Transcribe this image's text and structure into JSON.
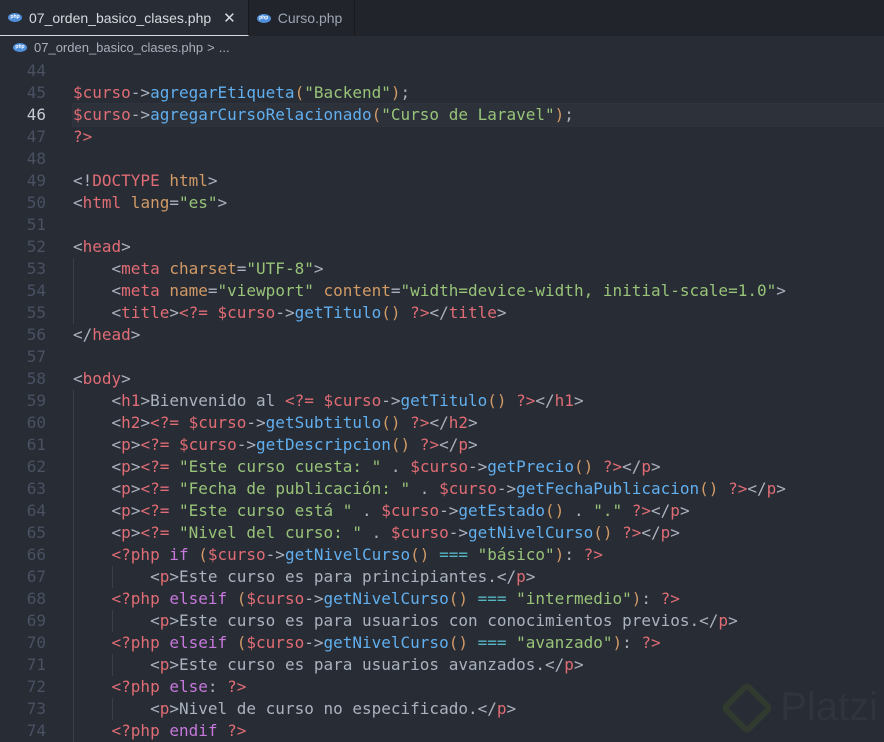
{
  "tabs": [
    {
      "label": "07_orden_basico_clases.php",
      "active": true,
      "close": "✕"
    },
    {
      "label": "Curso.php",
      "active": false
    }
  ],
  "breadcrumb": {
    "file": "07_orden_basico_clases.php",
    "sep": ">",
    "more": "..."
  },
  "icon_label": "php",
  "watermark": "Platzi",
  "current_line": 46,
  "lines": [
    {
      "n": "44",
      "t": []
    },
    {
      "n": "45",
      "t": [
        [
          "v",
          "$curso"
        ],
        [
          "x",
          "->"
        ],
        [
          "f",
          "agregarEtiqueta"
        ],
        [
          "p",
          "("
        ],
        [
          "s",
          "\"Backend\""
        ],
        [
          "p",
          ")"
        ],
        [
          "x",
          ";"
        ]
      ]
    },
    {
      "n": "46",
      "t": [
        [
          "v",
          "$curso"
        ],
        [
          "x",
          "->"
        ],
        [
          "f",
          "agregarCursoRelacionado"
        ],
        [
          "p",
          "("
        ],
        [
          "s",
          "\"Curso de Laravel\""
        ],
        [
          "p",
          ")"
        ],
        [
          "x",
          ";"
        ]
      ]
    },
    {
      "n": "47",
      "t": [
        [
          "t",
          "?>"
        ]
      ]
    },
    {
      "n": "48",
      "t": []
    },
    {
      "n": "49",
      "t": [
        [
          "x",
          "<!"
        ],
        [
          "t",
          "DOCTYPE"
        ],
        [
          "a",
          " html"
        ],
        [
          "x",
          ">"
        ]
      ]
    },
    {
      "n": "50",
      "t": [
        [
          "x",
          "<"
        ],
        [
          "t",
          "html"
        ],
        [
          "a",
          " lang"
        ],
        [
          "x",
          "="
        ],
        [
          "s",
          "\"es\""
        ],
        [
          "x",
          ">"
        ]
      ]
    },
    {
      "n": "51",
      "t": []
    },
    {
      "n": "52",
      "t": [
        [
          "x",
          "<"
        ],
        [
          "t",
          "head"
        ],
        [
          "x",
          ">"
        ]
      ]
    },
    {
      "n": "53",
      "i": 1,
      "t": [
        [
          "x",
          "<"
        ],
        [
          "t",
          "meta"
        ],
        [
          "a",
          " charset"
        ],
        [
          "x",
          "="
        ],
        [
          "s",
          "\"UTF-8\""
        ],
        [
          "x",
          ">"
        ]
      ]
    },
    {
      "n": "54",
      "i": 1,
      "t": [
        [
          "x",
          "<"
        ],
        [
          "t",
          "meta"
        ],
        [
          "a",
          " name"
        ],
        [
          "x",
          "="
        ],
        [
          "s",
          "\"viewport\""
        ],
        [
          "a",
          " content"
        ],
        [
          "x",
          "="
        ],
        [
          "s",
          "\"width=device-width, initial-scale=1.0\""
        ],
        [
          "x",
          ">"
        ]
      ]
    },
    {
      "n": "55",
      "i": 1,
      "t": [
        [
          "x",
          "<"
        ],
        [
          "t",
          "title"
        ],
        [
          "x",
          ">"
        ],
        [
          "t",
          "<?= "
        ],
        [
          "v",
          "$curso"
        ],
        [
          "x",
          "->"
        ],
        [
          "f",
          "getTitulo"
        ],
        [
          "p",
          "()"
        ],
        [
          "t",
          " ?>"
        ],
        [
          "x",
          "</"
        ],
        [
          "t",
          "title"
        ],
        [
          "x",
          ">"
        ]
      ]
    },
    {
      "n": "56",
      "t": [
        [
          "x",
          "</"
        ],
        [
          "t",
          "head"
        ],
        [
          "x",
          ">"
        ]
      ]
    },
    {
      "n": "57",
      "t": []
    },
    {
      "n": "58",
      "t": [
        [
          "x",
          "<"
        ],
        [
          "t",
          "body"
        ],
        [
          "x",
          ">"
        ]
      ]
    },
    {
      "n": "59",
      "i": 1,
      "t": [
        [
          "x",
          "<"
        ],
        [
          "t",
          "h1"
        ],
        [
          "x",
          ">Bienvenido al "
        ],
        [
          "t",
          "<?= "
        ],
        [
          "v",
          "$curso"
        ],
        [
          "x",
          "->"
        ],
        [
          "f",
          "getTitulo"
        ],
        [
          "p",
          "()"
        ],
        [
          "t",
          " ?>"
        ],
        [
          "x",
          "</"
        ],
        [
          "t",
          "h1"
        ],
        [
          "x",
          ">"
        ]
      ]
    },
    {
      "n": "60",
      "i": 1,
      "t": [
        [
          "x",
          "<"
        ],
        [
          "t",
          "h2"
        ],
        [
          "x",
          ">"
        ],
        [
          "t",
          "<?= "
        ],
        [
          "v",
          "$curso"
        ],
        [
          "x",
          "->"
        ],
        [
          "f",
          "getSubtitulo"
        ],
        [
          "p",
          "()"
        ],
        [
          "t",
          " ?>"
        ],
        [
          "x",
          "</"
        ],
        [
          "t",
          "h2"
        ],
        [
          "x",
          ">"
        ]
      ]
    },
    {
      "n": "61",
      "i": 1,
      "t": [
        [
          "x",
          "<"
        ],
        [
          "t",
          "p"
        ],
        [
          "x",
          ">"
        ],
        [
          "t",
          "<?= "
        ],
        [
          "v",
          "$curso"
        ],
        [
          "x",
          "->"
        ],
        [
          "f",
          "getDescripcion"
        ],
        [
          "p",
          "()"
        ],
        [
          "t",
          " ?>"
        ],
        [
          "x",
          "</"
        ],
        [
          "t",
          "p"
        ],
        [
          "x",
          ">"
        ]
      ]
    },
    {
      "n": "62",
      "i": 1,
      "t": [
        [
          "x",
          "<"
        ],
        [
          "t",
          "p"
        ],
        [
          "x",
          ">"
        ],
        [
          "t",
          "<?= "
        ],
        [
          "s",
          "\"Este curso cuesta: \""
        ],
        [
          "x",
          " . "
        ],
        [
          "v",
          "$curso"
        ],
        [
          "x",
          "->"
        ],
        [
          "f",
          "getPrecio"
        ],
        [
          "p",
          "()"
        ],
        [
          "t",
          " ?>"
        ],
        [
          "x",
          "</"
        ],
        [
          "t",
          "p"
        ],
        [
          "x",
          ">"
        ]
      ]
    },
    {
      "n": "63",
      "i": 1,
      "t": [
        [
          "x",
          "<"
        ],
        [
          "t",
          "p"
        ],
        [
          "x",
          ">"
        ],
        [
          "t",
          "<?= "
        ],
        [
          "s",
          "\"Fecha de publicación: \""
        ],
        [
          "x",
          " . "
        ],
        [
          "v",
          "$curso"
        ],
        [
          "x",
          "->"
        ],
        [
          "f",
          "getFechaPublicacion"
        ],
        [
          "p",
          "()"
        ],
        [
          "t",
          " ?>"
        ],
        [
          "x",
          "</"
        ],
        [
          "t",
          "p"
        ],
        [
          "x",
          ">"
        ]
      ]
    },
    {
      "n": "64",
      "i": 1,
      "t": [
        [
          "x",
          "<"
        ],
        [
          "t",
          "p"
        ],
        [
          "x",
          ">"
        ],
        [
          "t",
          "<?= "
        ],
        [
          "s",
          "\"Este curso está \""
        ],
        [
          "x",
          " . "
        ],
        [
          "v",
          "$curso"
        ],
        [
          "x",
          "->"
        ],
        [
          "f",
          "getEstado"
        ],
        [
          "p",
          "()"
        ],
        [
          "x",
          " . "
        ],
        [
          "s",
          "\".\""
        ],
        [
          "t",
          " ?>"
        ],
        [
          "x",
          "</"
        ],
        [
          "t",
          "p"
        ],
        [
          "x",
          ">"
        ]
      ]
    },
    {
      "n": "65",
      "i": 1,
      "t": [
        [
          "x",
          "<"
        ],
        [
          "t",
          "p"
        ],
        [
          "x",
          ">"
        ],
        [
          "t",
          "<?= "
        ],
        [
          "s",
          "\"Nivel del curso: \""
        ],
        [
          "x",
          " . "
        ],
        [
          "v",
          "$curso"
        ],
        [
          "x",
          "->"
        ],
        [
          "f",
          "getNivelCurso"
        ],
        [
          "p",
          "()"
        ],
        [
          "t",
          " ?>"
        ],
        [
          "x",
          "</"
        ],
        [
          "t",
          "p"
        ],
        [
          "x",
          ">"
        ]
      ]
    },
    {
      "n": "66",
      "i": 1,
      "t": [
        [
          "t",
          "<?php "
        ],
        [
          "k",
          "if "
        ],
        [
          "p",
          "("
        ],
        [
          "v",
          "$curso"
        ],
        [
          "x",
          "->"
        ],
        [
          "f",
          "getNivelCurso"
        ],
        [
          "p",
          "()"
        ],
        [
          "o",
          " === "
        ],
        [
          "s",
          "\"básico\""
        ],
        [
          "p",
          ")"
        ],
        [
          "x",
          ": "
        ],
        [
          "t",
          "?>"
        ]
      ]
    },
    {
      "n": "67",
      "i": 2,
      "t": [
        [
          "x",
          "<"
        ],
        [
          "t",
          "p"
        ],
        [
          "x",
          ">Este curso es para principiantes.</"
        ],
        [
          "t",
          "p"
        ],
        [
          "x",
          ">"
        ]
      ]
    },
    {
      "n": "68",
      "i": 1,
      "t": [
        [
          "t",
          "<?php "
        ],
        [
          "k",
          "elseif "
        ],
        [
          "p",
          "("
        ],
        [
          "v",
          "$curso"
        ],
        [
          "x",
          "->"
        ],
        [
          "f",
          "getNivelCurso"
        ],
        [
          "p",
          "()"
        ],
        [
          "o",
          " === "
        ],
        [
          "s",
          "\"intermedio\""
        ],
        [
          "p",
          ")"
        ],
        [
          "x",
          ": "
        ],
        [
          "t",
          "?>"
        ]
      ]
    },
    {
      "n": "69",
      "i": 2,
      "t": [
        [
          "x",
          "<"
        ],
        [
          "t",
          "p"
        ],
        [
          "x",
          ">Este curso es para usuarios con conocimientos previos.</"
        ],
        [
          "t",
          "p"
        ],
        [
          "x",
          ">"
        ]
      ]
    },
    {
      "n": "70",
      "i": 1,
      "t": [
        [
          "t",
          "<?php "
        ],
        [
          "k",
          "elseif "
        ],
        [
          "p",
          "("
        ],
        [
          "v",
          "$curso"
        ],
        [
          "x",
          "->"
        ],
        [
          "f",
          "getNivelCurso"
        ],
        [
          "p",
          "()"
        ],
        [
          "o",
          " === "
        ],
        [
          "s",
          "\"avanzado\""
        ],
        [
          "p",
          ")"
        ],
        [
          "x",
          ": "
        ],
        [
          "t",
          "?>"
        ]
      ]
    },
    {
      "n": "71",
      "i": 2,
      "t": [
        [
          "x",
          "<"
        ],
        [
          "t",
          "p"
        ],
        [
          "x",
          ">Este curso es para usuarios avanzados.</"
        ],
        [
          "t",
          "p"
        ],
        [
          "x",
          ">"
        ]
      ]
    },
    {
      "n": "72",
      "i": 1,
      "t": [
        [
          "t",
          "<?php "
        ],
        [
          "k",
          "else"
        ],
        [
          "x",
          ": "
        ],
        [
          "t",
          "?>"
        ]
      ]
    },
    {
      "n": "73",
      "i": 2,
      "t": [
        [
          "x",
          "<"
        ],
        [
          "t",
          "p"
        ],
        [
          "x",
          ">Nivel de curso no especificado.</"
        ],
        [
          "t",
          "p"
        ],
        [
          "x",
          ">"
        ]
      ]
    },
    {
      "n": "74",
      "i": 1,
      "t": [
        [
          "t",
          "<?php "
        ],
        [
          "k",
          "endif"
        ],
        [
          "t",
          " ?>"
        ]
      ]
    }
  ]
}
